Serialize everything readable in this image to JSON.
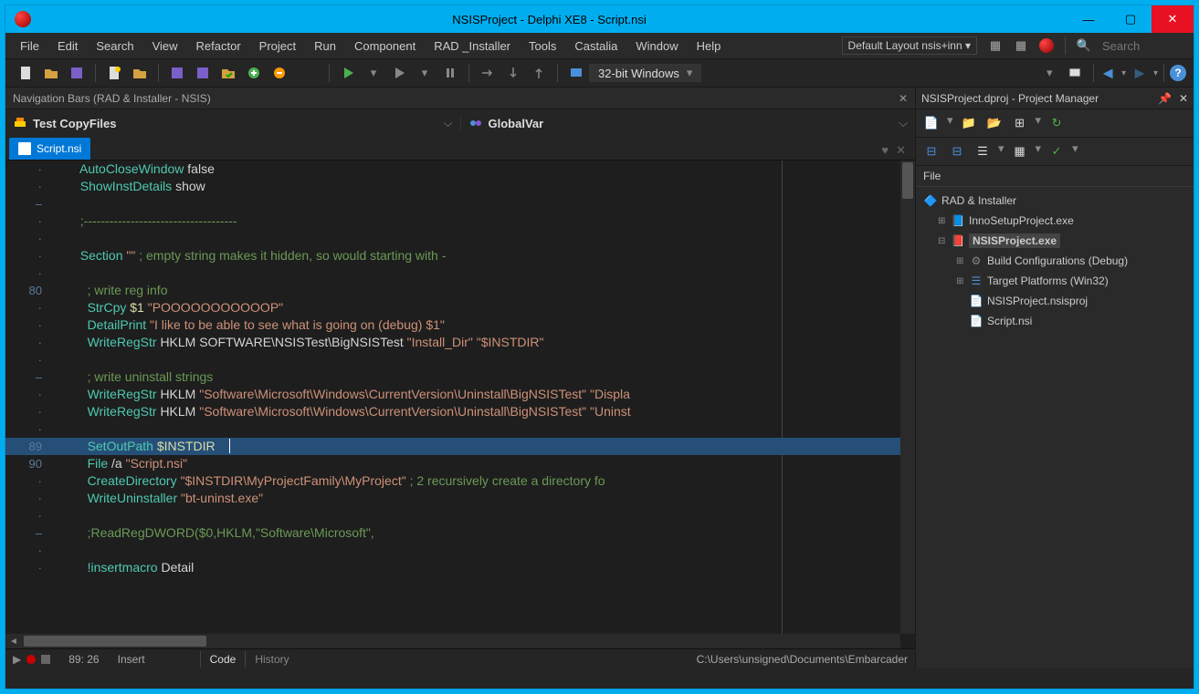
{
  "title": "NSISProject - Delphi XE8 - Script.nsi",
  "menu": [
    "File",
    "Edit",
    "Search",
    "View",
    "Refactor",
    "Project",
    "Run",
    "Component",
    "RAD _Installer",
    "Tools",
    "Castalia",
    "Window",
    "Help"
  ],
  "layout_selector": "Default Layout nsis+inn",
  "search_placeholder": "Search",
  "target_platform": "32-bit Windows",
  "nav_header": "Navigation Bars (RAD & Installer - NSIS)",
  "crumb1": "Test CopyFiles",
  "crumb2": "GlobalVar",
  "active_tab": "Script.nsi",
  "project_manager": {
    "title": "NSISProject.dproj - Project Manager",
    "section": "File",
    "root": "RAD & Installer",
    "items": {
      "inno": "InnoSetupProject.exe",
      "nsis": "NSISProject.exe",
      "build": "Build Configurations (Debug)",
      "target": "Target Platforms (Win32)",
      "proj": "NSISProject.nsisproj",
      "script": "Script.nsi"
    }
  },
  "code": {
    "l1": {
      "n": "·",
      "a": "AutoCloseWindow",
      "b": "false"
    },
    "l2": {
      "n": "·",
      "a": "ShowInstDetails",
      "b": "show"
    },
    "l3": {
      "n": "–"
    },
    "l4": {
      "n": "·",
      "cmt": ";------------------------------------"
    },
    "l5": {
      "n": "·"
    },
    "l6": {
      "n": "·",
      "a": "Section",
      "str": "\"\"",
      "cmt": " ; empty string makes it hidden, so would starting with -"
    },
    "l7": {
      "n": "·"
    },
    "l8": {
      "n": "80",
      "cmt": "; write reg info"
    },
    "l9": {
      "n": "·",
      "a": "StrCpy",
      "v": "$1",
      "str": "\"POOOOOOOOOOOP\""
    },
    "l10": {
      "n": "·",
      "a": "DetailPrint",
      "str": "\"I like to be able to see what is going on (debug) $1\""
    },
    "l11": {
      "n": "·",
      "a": "WriteRegStr",
      "c": "HKLM SOFTWARE\\NSISTest\\BigNSISTest",
      "s1": "\"Install_Dir\"",
      "s2": "\"$INSTDIR\""
    },
    "l12": {
      "n": "·"
    },
    "l13": {
      "n": "–",
      "cmt": "; write uninstall strings"
    },
    "l14": {
      "n": "·",
      "a": "WriteRegStr",
      "c": "HKLM",
      "s1": "\"Software\\Microsoft\\Windows\\CurrentVersion\\Uninstall\\BigNSISTest\"",
      "s2": "\"Displa"
    },
    "l15": {
      "n": "·",
      "a": "WriteRegStr",
      "c": "HKLM",
      "s1": "\"Software\\Microsoft\\Windows\\CurrentVersion\\Uninstall\\BigNSISTest\"",
      "s2": "\"Uninst"
    },
    "l16": {
      "n": "·"
    },
    "l17": {
      "n": "89",
      "a": "SetOutPath",
      "v": "$INSTDIR",
      "hl": true
    },
    "l18": {
      "n": "90",
      "a": "File",
      "c": "/a",
      "str": "\"Script.nsi\""
    },
    "l19": {
      "n": "·",
      "a": "CreateDirectory",
      "str": "\"$INSTDIR\\MyProjectFamily\\MyProject\"",
      "cmt": " ; 2 recursively create a directory fo"
    },
    "l20": {
      "n": "·",
      "a": "WriteUninstaller",
      "str": "\"bt-uninst.exe\""
    },
    "l21": {
      "n": "·"
    },
    "l22": {
      "n": "–",
      "cmt": ";ReadRegDWORD($0,HKLM,\"Software\\Microsoft\","
    },
    "l23": {
      "n": "·"
    },
    "l24": {
      "n": "·",
      "a": "!insertmacro",
      "c": "Detail"
    }
  },
  "bottom_tabs": {
    "code": "Code",
    "history": "History"
  },
  "status": {
    "pos": "89: 26",
    "mode": "Insert",
    "path": "C:\\Users\\unsigned\\Documents\\Embarcader"
  }
}
